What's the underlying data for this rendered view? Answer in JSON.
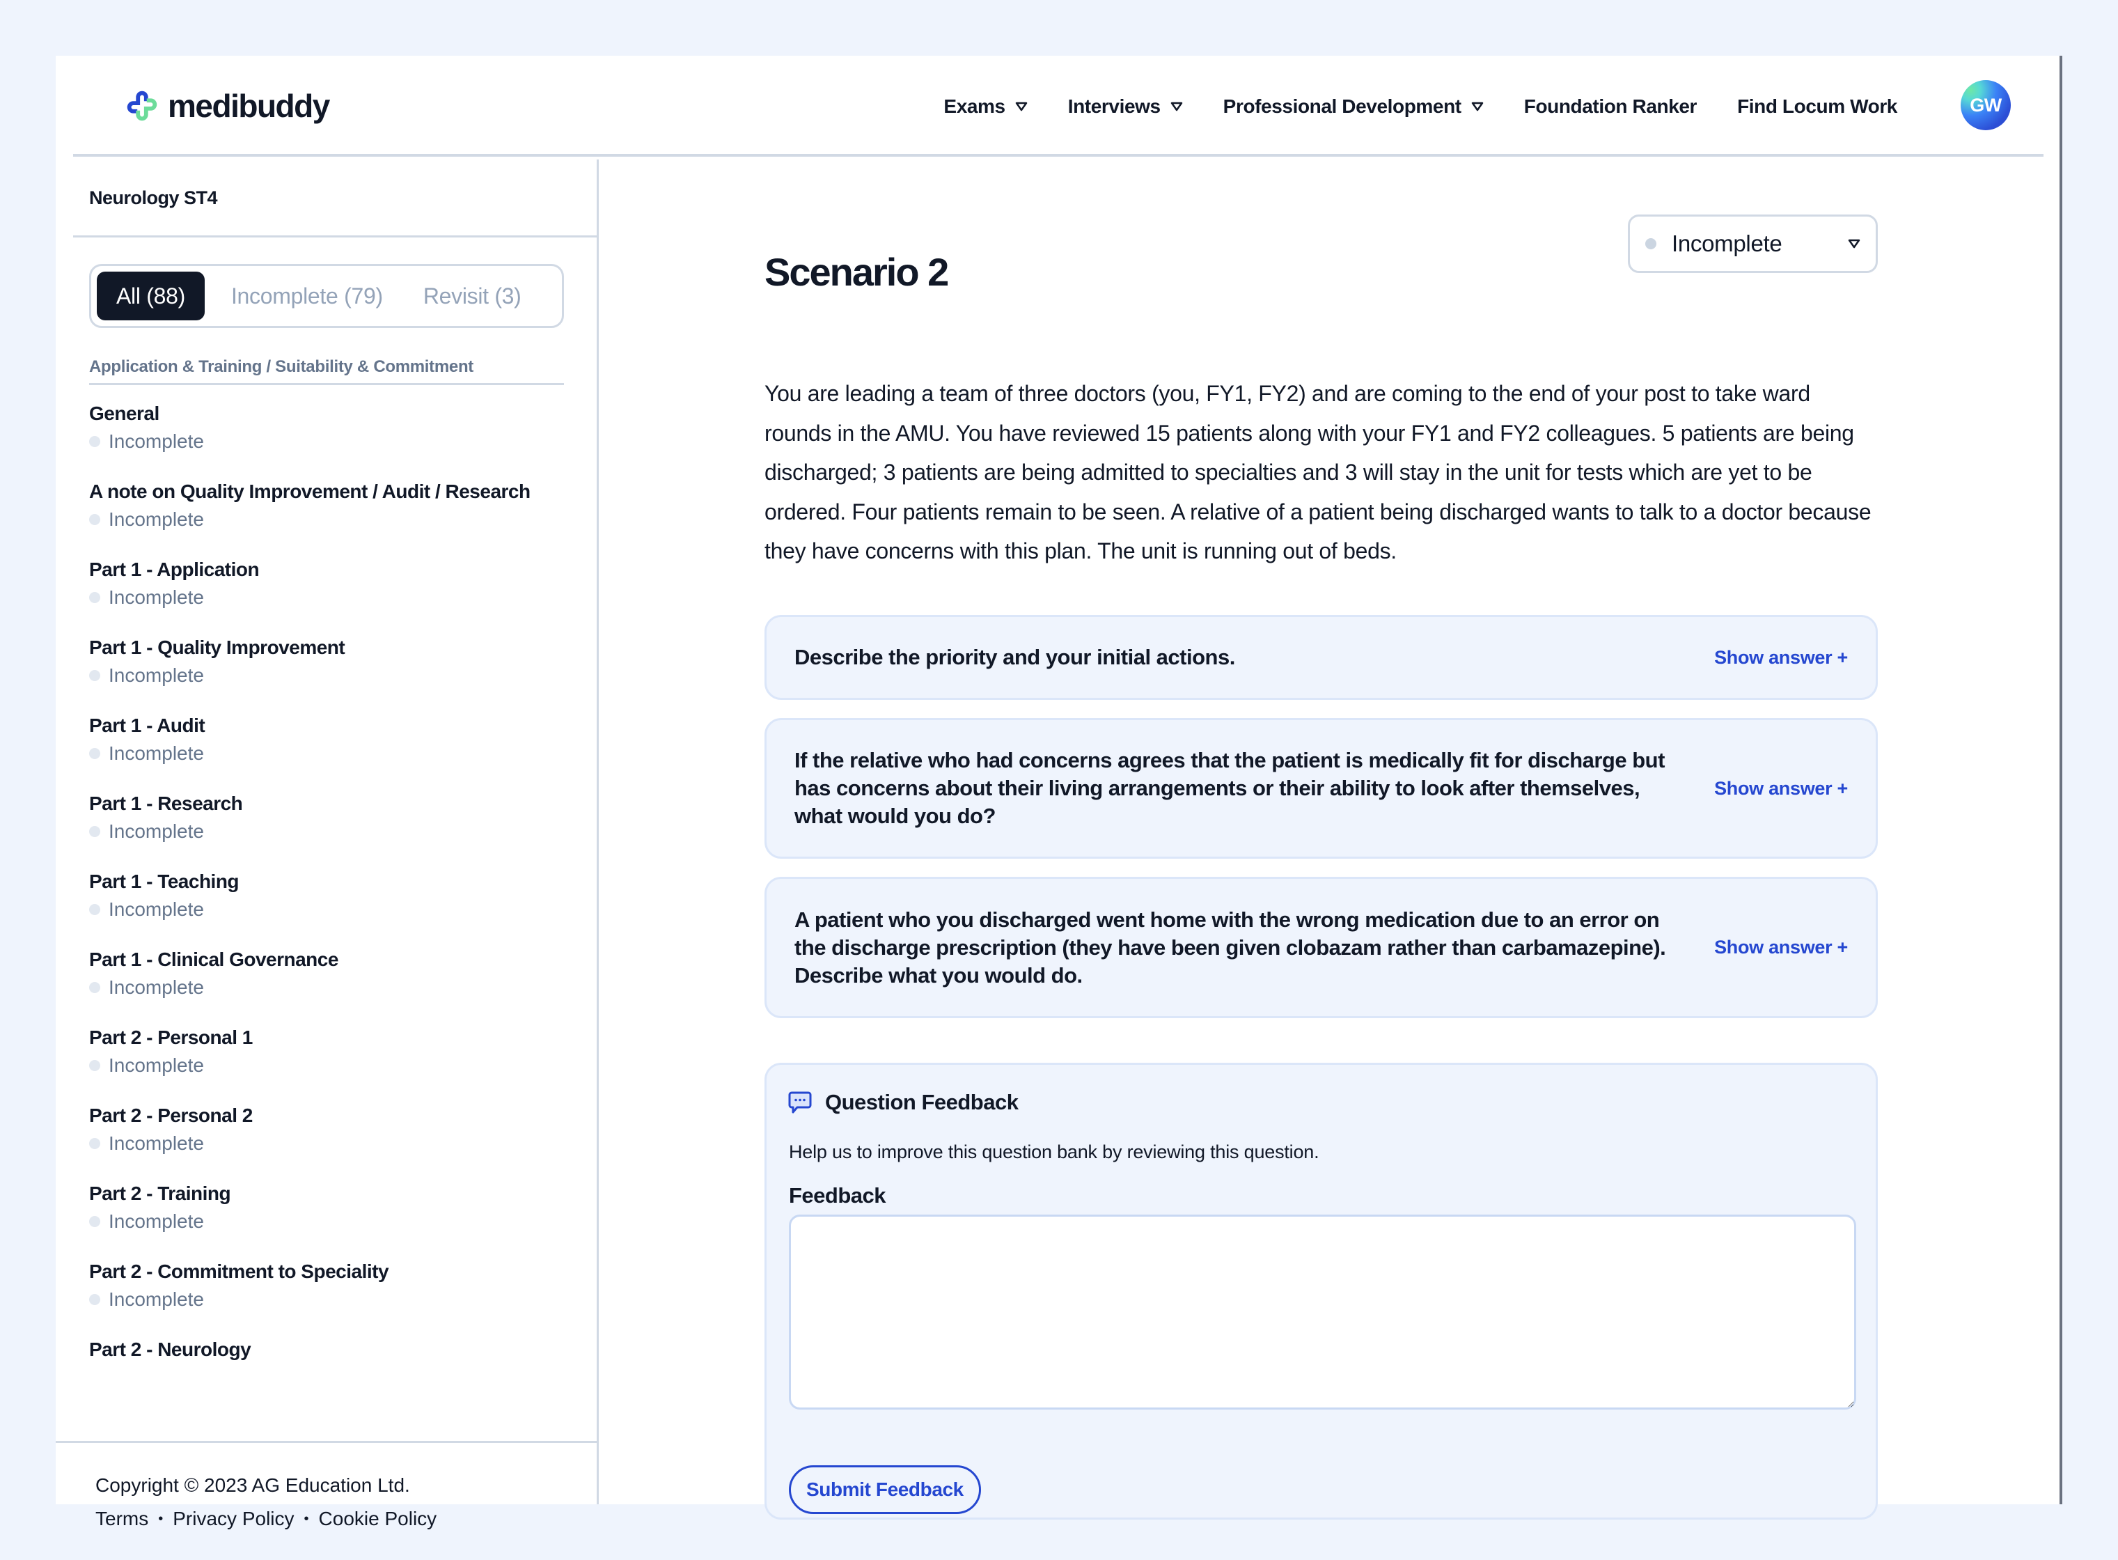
{
  "brand": {
    "name": "medibuddy",
    "colors": {
      "primary": "#2547d0",
      "green": "#6ddc9a",
      "dark": "#111827",
      "page_bg": "#eff4fd"
    }
  },
  "nav": {
    "items": [
      {
        "label": "Exams",
        "has_dropdown": true
      },
      {
        "label": "Interviews",
        "has_dropdown": true
      },
      {
        "label": "Professional Development",
        "has_dropdown": true
      },
      {
        "label": "Foundation Ranker",
        "has_dropdown": false
      },
      {
        "label": "Find Locum Work",
        "has_dropdown": false
      }
    ],
    "avatar_initials": "GW"
  },
  "sidebar": {
    "title": "Neurology ST4",
    "tabs": [
      {
        "label": "All (88)",
        "active": true
      },
      {
        "label": "Incomplete (79)",
        "active": false
      },
      {
        "label": "Revisit (3)",
        "active": false
      }
    ],
    "category": "Application & Training / Suitability & Commitment",
    "items": [
      {
        "title": "General",
        "status": "Incomplete"
      },
      {
        "title": "A note on Quality Improvement / Audit / Research",
        "status": "Incomplete"
      },
      {
        "title": "Part 1 - Application",
        "status": "Incomplete"
      },
      {
        "title": "Part 1 - Quality Improvement",
        "status": "Incomplete"
      },
      {
        "title": "Part 1 - Audit",
        "status": "Incomplete"
      },
      {
        "title": "Part 1 - Research",
        "status": "Incomplete"
      },
      {
        "title": "Part 1 - Teaching",
        "status": "Incomplete"
      },
      {
        "title": "Part 1 - Clinical Governance",
        "status": "Incomplete"
      },
      {
        "title": "Part 2 - Personal 1",
        "status": "Incomplete"
      },
      {
        "title": "Part 2 - Personal 2",
        "status": "Incomplete"
      },
      {
        "title": "Part 2 - Training",
        "status": "Incomplete"
      },
      {
        "title": "Part 2 - Commitment to Speciality",
        "status": "Incomplete"
      },
      {
        "title": "Part 2 - Neurology",
        "status": ""
      }
    ],
    "footer": {
      "copyright": "Copyright © 2023 AG Education Ltd.",
      "links": [
        "Terms",
        "Privacy Policy",
        "Cookie Policy"
      ],
      "separator": "•"
    }
  },
  "main": {
    "title": "Scenario 2",
    "status_select": {
      "value": "Incomplete"
    },
    "scenario_text": "You are leading a team of three doctors (you, FY1, FY2) and are coming to the end of your post to take ward rounds in the AMU. You have reviewed 15 patients along with your FY1 and FY2 colleagues. 5 patients are being discharged; 3 patients are being admitted to specialties and 3 will stay in the unit for tests which are yet to be ordered. Four patients remain to be seen. A relative of a patient being discharged wants to talk to a doctor because they have concerns with this plan. The unit is running out of beds.",
    "questions": [
      {
        "text": "Describe the priority and your initial actions.",
        "action": "Show answer +"
      },
      {
        "text": "If the relative who had concerns agrees that the patient is medically fit for discharge but has concerns about their living arrangements or their ability to look after themselves, what would you do?",
        "action": "Show answer +"
      },
      {
        "text": "A patient who you discharged went home with the wrong medication due to an error on the discharge prescription (they have been given clobazam rather than carbamazepine). Describe what you would do.",
        "action": "Show answer +"
      }
    ],
    "feedback": {
      "title": "Question Feedback",
      "description": "Help us to improve this question bank by reviewing this question.",
      "field_label": "Feedback",
      "field_value": "",
      "field_placeholder": "",
      "submit_label": "Submit Feedback"
    }
  }
}
